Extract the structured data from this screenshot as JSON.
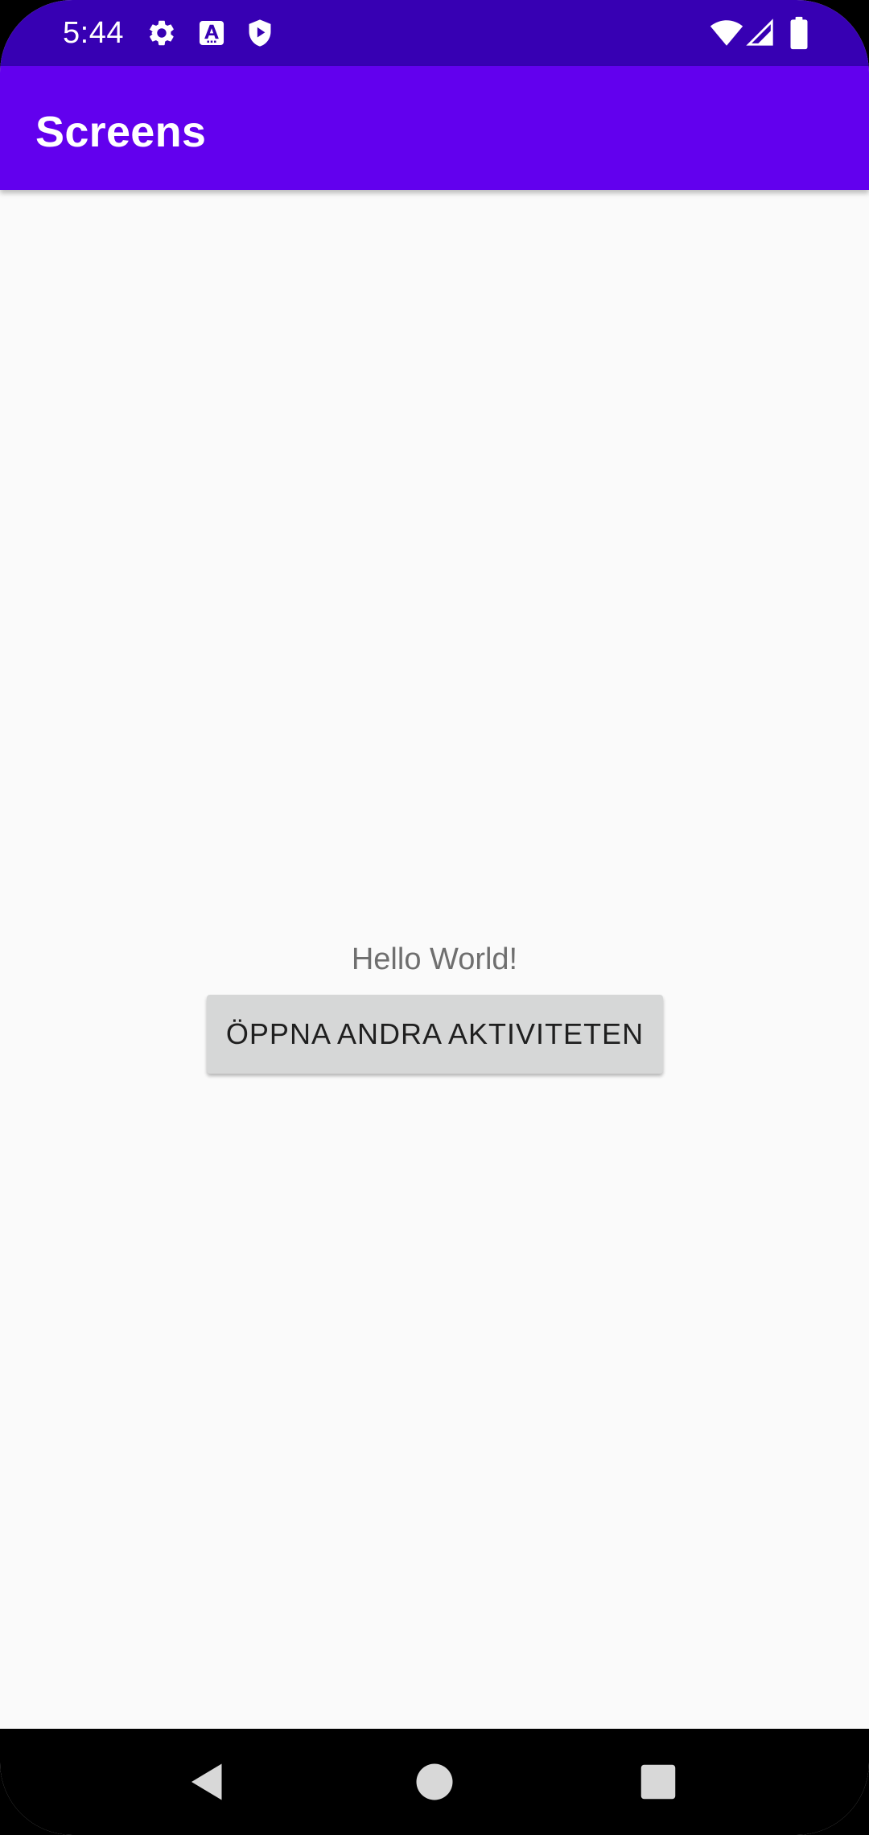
{
  "status_bar": {
    "time": "5:44",
    "left_icons": [
      "gear-icon",
      "text-icon",
      "shield-play-icon"
    ],
    "right_icons": [
      "wifi-icon",
      "signal-icon",
      "battery-icon"
    ],
    "color": "#3700b3"
  },
  "app_bar": {
    "title": "Screens",
    "color": "#6200ee"
  },
  "main": {
    "hello_text": "Hello World!",
    "button_label": "ÖPPNA ANDRA AKTIVITETEN"
  },
  "nav_bar": {
    "buttons": [
      "back-icon",
      "home-icon",
      "recents-icon"
    ]
  }
}
